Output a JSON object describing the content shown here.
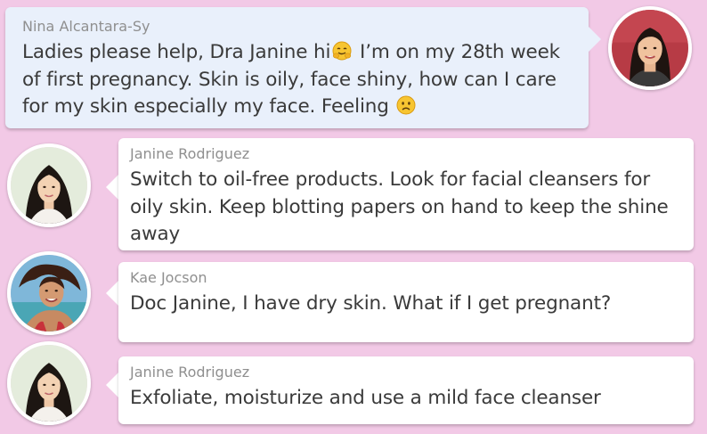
{
  "messages": [
    {
      "author": "Nina Alcantara-Sy",
      "text_before_emoji": "Ladies please help, Dra Janine hi",
      "emoji_1": "hugging-face-emoji",
      "text_after_emoji": " I’m on my 28th week of first pregnancy. Skin is oily, face shiny, how can I care for my skin especially my face. Feeling",
      "emoji_2": "worried-face-emoji",
      "side": "right"
    },
    {
      "author": "Janine Rodriguez",
      "text": "Switch to oil-free products. Look for facial cleansers for oily skin. Keep blotting papers on hand to keep the shine away",
      "side": "left"
    },
    {
      "author": "Kae Jocson",
      "text": "Doc Janine, I have dry skin. What if I get pregnant?",
      "side": "left"
    },
    {
      "author": "Janine Rodriguez",
      "text": "Exfoliate, moisturize and use a mild face cleanser",
      "side": "left"
    }
  ],
  "colors": {
    "background": "#f2c9e6",
    "right_bubble": "#e9f0fb",
    "left_bubble": "#ffffff",
    "author_name": "#8f8f8f",
    "message_text": "#3a3a3a"
  }
}
